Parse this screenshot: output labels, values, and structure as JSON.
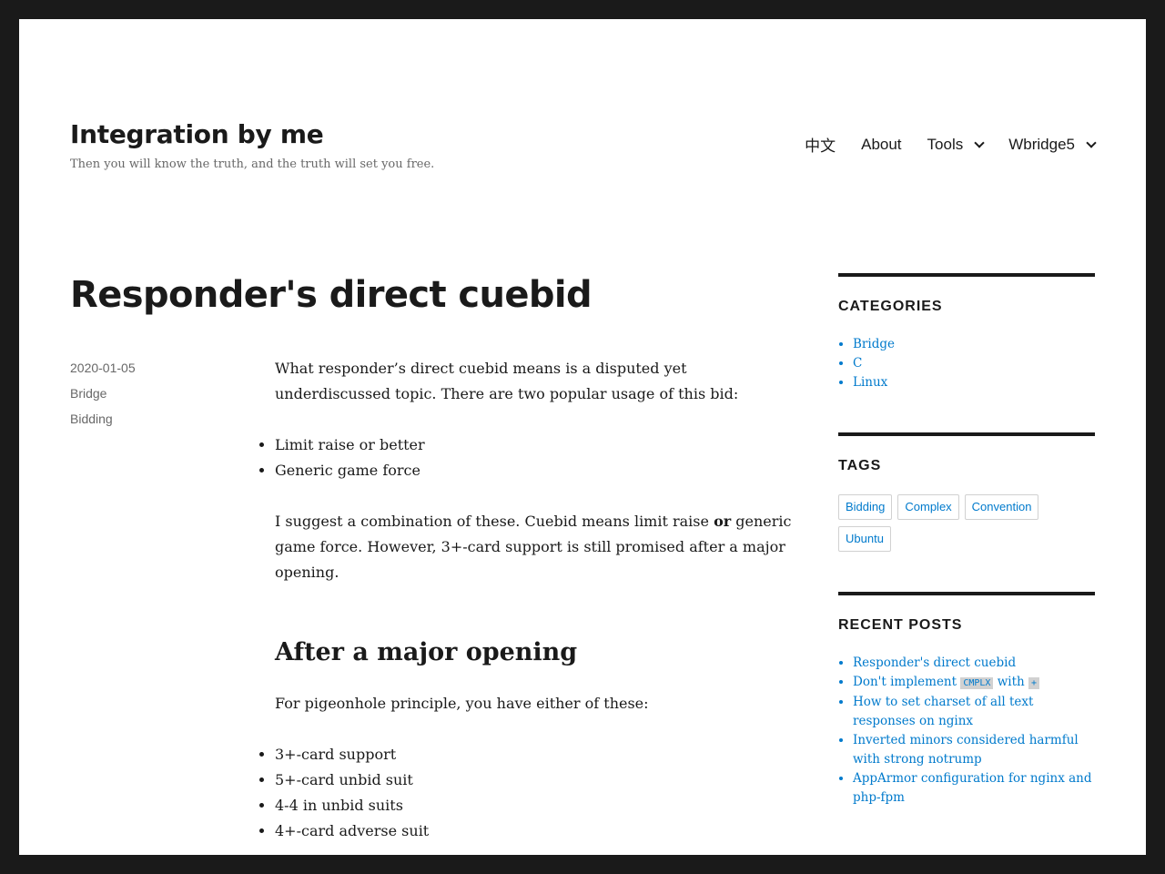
{
  "header": {
    "site_title": "Integration by me",
    "site_description": "Then you will know the truth, and the truth will set you free."
  },
  "nav": {
    "items": [
      {
        "label": "中文",
        "has_submenu": false
      },
      {
        "label": "About",
        "has_submenu": false
      },
      {
        "label": "Tools",
        "has_submenu": true
      },
      {
        "label": "Wbridge5",
        "has_submenu": true
      }
    ]
  },
  "article": {
    "title": "Responder's direct cuebid",
    "meta": {
      "date": "2020-01-05",
      "category": "Bridge",
      "tag": "Bidding"
    },
    "intro": "What responder’s direct cuebid means is a disputed yet underdiscussed topic. There are two popular usage of this bid:",
    "usages": [
      "Limit raise or better",
      "Generic game force"
    ],
    "suggestion_before": "I suggest a combination of these. Cuebid means limit raise ",
    "suggestion_bold": "or",
    "suggestion_after": " generic game force. However, 3+-card support is still promised after a major opening.",
    "section_heading": "After a major opening",
    "section_intro": "For pigeonhole principle, you have either of these:",
    "cases": [
      "3+-card support",
      "5+-card unbid suit",
      "4-4 in unbid suits",
      "4+-card adverse suit"
    ]
  },
  "sidebar": {
    "categories": {
      "title": "CATEGORIES",
      "items": [
        "Bridge",
        "C",
        "Linux"
      ]
    },
    "tags": {
      "title": "TAGS",
      "items": [
        "Bidding",
        "Complex",
        "Convention",
        "Ubuntu"
      ]
    },
    "recent_posts": {
      "title": "RECENT POSTS",
      "item1": "Responder's direct cuebid",
      "item2_pre": "Don't implement ",
      "item2_code1": "CMPLX",
      "item2_mid": " with ",
      "item2_code2": "+",
      "item3": "How to set charset of all text responses on nginx",
      "item4": "Inverted minors considered harmful with strong notrump",
      "item5": "AppArmor configuration for nginx and php-fpm"
    }
  },
  "colors": {
    "page_border": "#1a1a1a",
    "link": "#007acc",
    "text": "#1a1a1a",
    "muted": "#686868"
  }
}
